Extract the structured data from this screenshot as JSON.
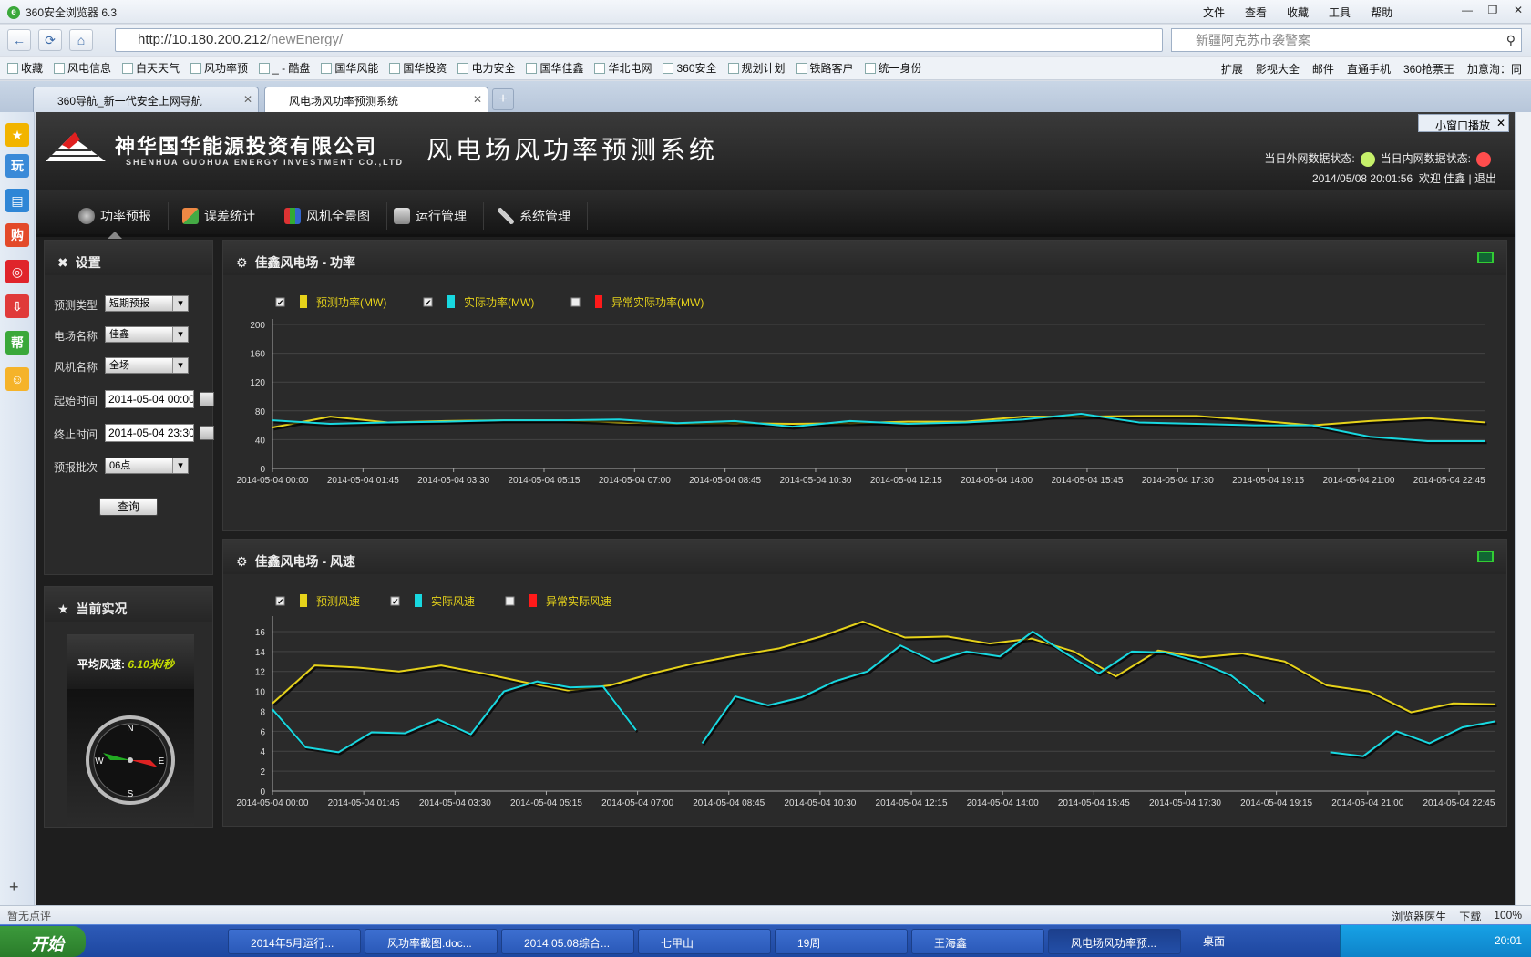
{
  "browser": {
    "title": "360安全浏览器 6.3",
    "menu": [
      "文件",
      "查看",
      "收藏",
      "工具",
      "帮助"
    ],
    "url_host": "http://10.180.200.212",
    "url_path": "/newEnergy/",
    "search_text": "新疆阿克苏市袭警案",
    "favorites": [
      "收藏",
      "风电信息",
      "白天天气",
      "风功率预",
      "_ - 酷盘",
      "国华风能",
      "国华投资",
      "电力安全",
      "国华佳鑫",
      "华北电网",
      "360安全",
      "规划计划",
      "铁路客户",
      "统一身份"
    ],
    "fav_right": [
      "扩展",
      "影视大全",
      "邮件",
      "直通手机",
      "360抢票王",
      "加意淘：同"
    ],
    "tabs": [
      "360导航_新一代安全上网导航",
      "风电场风功率预测系统"
    ],
    "mini_play": "小窗口播放",
    "status_left": "暂无点评",
    "status_right": [
      "浏览器医生",
      "下载",
      "100%"
    ]
  },
  "app": {
    "company_cn": "神华国华能源投资有限公司",
    "company_en": "SHENHUA GUOHUA ENERGY INVESTMENT CO.,LTD",
    "system_title": "风电场风功率预测系统",
    "ext_status": "当日外网数据状态:",
    "int_status": "当日内网数据状态:",
    "datetime": "2014/05/08 20:01:56",
    "welcome": "欢迎",
    "user": "佳鑫",
    "logout": "退出",
    "ext_color": "#c6f06a",
    "int_color": "#ff4d4d",
    "nav": [
      "功率预报",
      "误差统计",
      "风机全景图",
      "运行管理",
      "系统管理"
    ]
  },
  "settings": {
    "title": "设置",
    "labels": [
      "预测类型",
      "电场名称",
      "风机名称",
      "起始时间",
      "终止时间",
      "预报批次"
    ],
    "values": [
      "短期预报",
      "佳鑫",
      "全场",
      "2014-05-04 00:00",
      "2014-05-04 23:30",
      "06点"
    ],
    "query": "查询"
  },
  "now": {
    "title": "当前实况",
    "avg_label": "平均风速:",
    "avg_value": "6.10米/秒",
    "compass": [
      "N",
      "E",
      "S",
      "W"
    ]
  },
  "chart_data": [
    {
      "type": "line",
      "title": "佳鑫风电场 - 功率",
      "ylim": [
        0,
        200
      ],
      "yticks": [
        0,
        40,
        80,
        120,
        160,
        200
      ],
      "x": [
        "2014-05-04 00:00",
        "2014-05-04 01:45",
        "2014-05-04 03:30",
        "2014-05-04 05:15",
        "2014-05-04 07:00",
        "2014-05-04 08:45",
        "2014-05-04 10:30",
        "2014-05-04 12:15",
        "2014-05-04 14:00",
        "2014-05-04 15:45",
        "2014-05-04 17:30",
        "2014-05-04 19:15",
        "2014-05-04 21:00",
        "2014-05-04 22:45"
      ],
      "legend": [
        "预测功率(MW)",
        "实际功率(MW)",
        "异常实际功率(MW)"
      ],
      "colors": [
        "#e6d21a",
        "#18d8e0",
        "#ff1a1a"
      ],
      "series": [
        {
          "name": "预测功率(MW)",
          "values": [
            57,
            72,
            64,
            66,
            67,
            67,
            64,
            62,
            63,
            62,
            63,
            65,
            65,
            72,
            72,
            73,
            73,
            67,
            60,
            66,
            70,
            64
          ]
        },
        {
          "name": "实际功率(MW)",
          "values": [
            67,
            62,
            64,
            65,
            67,
            67,
            68,
            63,
            66,
            58,
            66,
            62,
            64,
            68,
            76,
            64,
            62,
            60,
            60,
            44,
            38,
            38
          ]
        },
        {
          "name": "异常实际功率(MW)",
          "values": []
        }
      ]
    },
    {
      "type": "line",
      "title": "佳鑫风电场 - 风速",
      "ylim": [
        0,
        17
      ],
      "yticks": [
        0,
        2,
        4,
        6,
        8,
        10,
        12,
        14,
        16
      ],
      "x": [
        "2014-05-04 00:00",
        "2014-05-04 01:45",
        "2014-05-04 03:30",
        "2014-05-04 05:15",
        "2014-05-04 07:00",
        "2014-05-04 08:45",
        "2014-05-04 10:30",
        "2014-05-04 12:15",
        "2014-05-04 14:00",
        "2014-05-04 15:45",
        "2014-05-04 17:30",
        "2014-05-04 19:15",
        "2014-05-04 21:00",
        "2014-05-04 22:45"
      ],
      "legend": [
        "预测风速",
        "实际风速",
        "异常实际风速"
      ],
      "colors": [
        "#e6d21a",
        "#18d8e0",
        "#ff1a1a"
      ],
      "series": [
        {
          "name": "预测风速",
          "values": [
            8.8,
            12.6,
            12.4,
            12.0,
            12.6,
            11.8,
            10.9,
            10.1,
            10.6,
            11.8,
            12.8,
            13.6,
            14.3,
            15.5,
            17.0,
            15.4,
            15.5,
            14.8,
            15.3,
            14.0,
            11.5,
            14.1,
            13.4,
            13.8,
            13.0,
            10.6,
            10.0,
            7.9,
            8.8,
            8.7
          ]
        },
        {
          "name": "实际风速",
          "values": [
            8.2,
            4.4,
            3.9,
            5.9,
            5.8,
            7.2,
            5.7,
            10.0,
            11.0,
            10.4,
            10.5,
            6.1,
            null,
            4.8,
            9.5,
            8.6,
            9.4,
            11.0,
            12.0,
            14.6,
            13.0,
            14.0,
            13.5,
            16.0,
            13.8,
            11.8,
            14.0,
            13.9,
            13.0,
            11.6,
            9.0,
            null,
            3.9,
            3.5,
            6.0,
            4.8,
            6.4,
            7.0
          ]
        },
        {
          "name": "异常实际风速",
          "values": []
        }
      ]
    }
  ],
  "taskbar": {
    "start": "开始",
    "items": [
      "2014年5月运行...",
      "风功率截图.doc...",
      "2014.05.08综合...",
      "七甲山",
      "19周",
      "王海鑫",
      "风电场风功率预..."
    ],
    "tray_left": "桌面",
    "clock": "20:01"
  }
}
